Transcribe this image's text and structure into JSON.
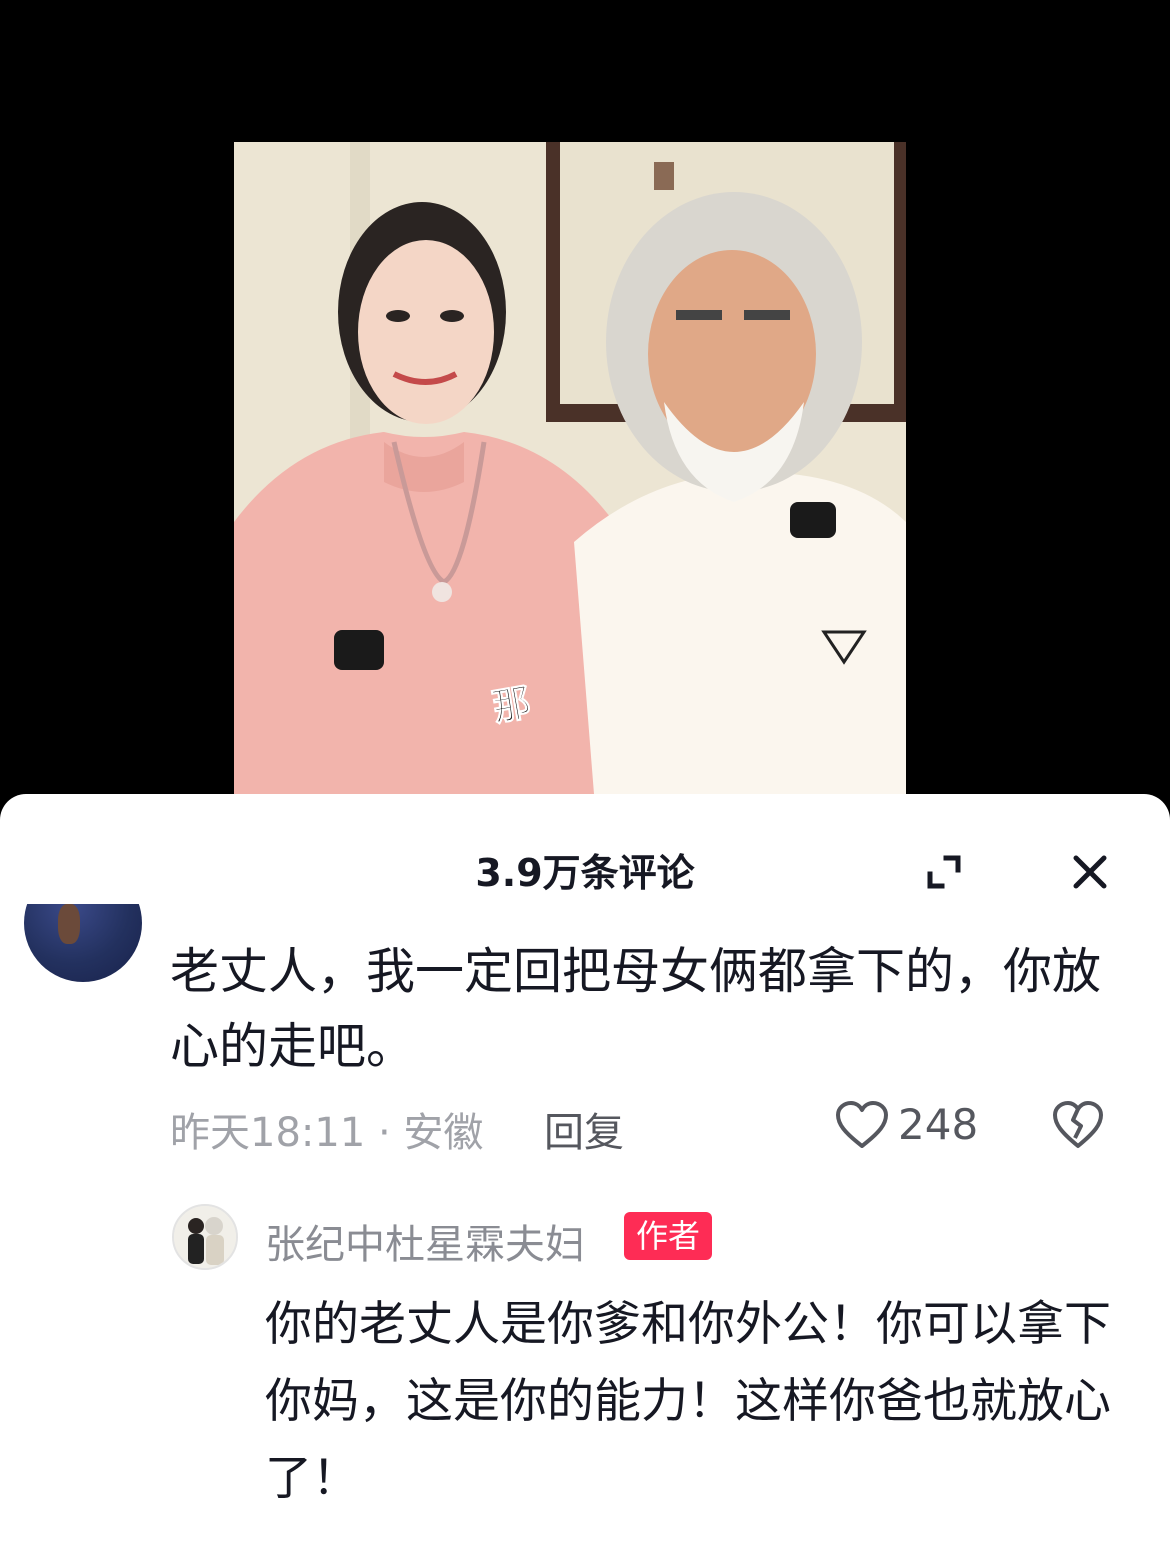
{
  "video": {
    "caption_char": "那"
  },
  "comments_panel": {
    "title": "3.9万条评论",
    "icons": {
      "expand": "expand-icon",
      "close": "close-icon"
    }
  },
  "comment": {
    "text": "老丈人，我一定回把母女俩都拿下的，你放心的走吧。",
    "time_location": "昨天18:11 · 安徽",
    "reply_label": "回复",
    "like_count": "248",
    "icons": {
      "like": "heart-outline-icon",
      "dislike": "broken-heart-icon"
    }
  },
  "reply": {
    "author": "张纪中杜星霖夫妇",
    "badge": "作者",
    "text": "你的老丈人是你爹和你外公！你可以拿下你妈，这是你的能力！这样你爸也就放心了！"
  },
  "colors": {
    "badge": "#fe2c55",
    "text_primary": "#161823",
    "text_secondary": "#a0a2a8"
  }
}
